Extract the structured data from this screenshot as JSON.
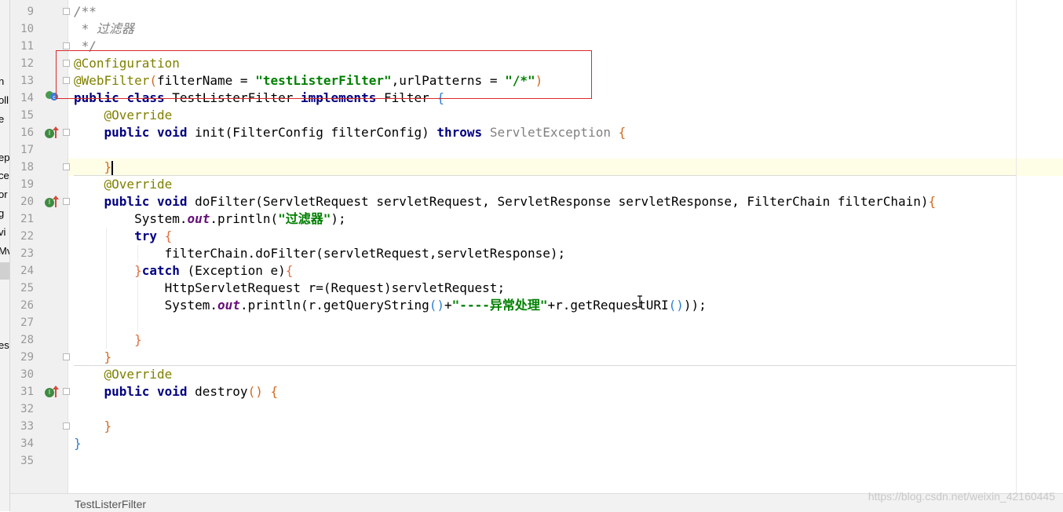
{
  "left_panel": {
    "items": [
      "n",
      "oll",
      "e",
      "ep",
      "ce",
      "or",
      "g",
      "vi",
      "Mv",
      "es"
    ]
  },
  "breadcrumb": "TestListerFilter",
  "watermark": "https://blog.csdn.net/weixin_42160445",
  "line_numbers": [
    "9",
    "10",
    "11",
    "12",
    "13",
    "14",
    "15",
    "16",
    "17",
    "18",
    "19",
    "20",
    "21",
    "22",
    "23",
    "24",
    "25",
    "26",
    "27",
    "28",
    "29",
    "30",
    "31",
    "32",
    "33",
    "34",
    "35"
  ],
  "code": {
    "l9": "/**",
    "l10": " * 过滤器",
    "l11": " */",
    "l12": "@Configuration",
    "l13_ann": "@WebFilter",
    "l13_p1": "filterName = ",
    "l13_s1": "\"testListerFilter\"",
    "l13_p2": ",urlPatterns = ",
    "l13_s2": "\"/*\"",
    "kw_public": "public",
    "kw_class": "class",
    "kw_void": "void",
    "kw_implements": "implements",
    "kw_throws": "throws",
    "kw_try": "try",
    "kw_catch": "catch",
    "l14_name": " TestListerFilter ",
    "l14_iface": " Filter ",
    "override": "@Override",
    "l16_sig": " init(FilterConfig filterConfig) ",
    "l16_exc": "ServletException",
    "l20_sig": " doFilter(ServletRequest servletRequest, ServletResponse servletResponse, FilterChain filterChain)",
    "sys": "System.",
    "out": "out",
    "println": ".println(",
    "l21_str": "\"过滤器\"",
    "l23": "filterChain.doFilter(servletRequest,servletResponse);",
    "l24_exc": " (Exception e)",
    "l25": "HttpServletRequest r=(Request)servletRequest;",
    "l26_a": "r.getQueryString",
    "l26_str": "\"----异常处理\"",
    "l26_b": "+r.getRequestURI",
    "l31_sig": " destroy",
    "semi": ");",
    "close_paren_semi": "));"
  },
  "colors": {
    "keyword": "#000080",
    "annotation": "#808000",
    "string": "#008000",
    "comment": "#808080",
    "highlight_box": "#d92a2a"
  }
}
